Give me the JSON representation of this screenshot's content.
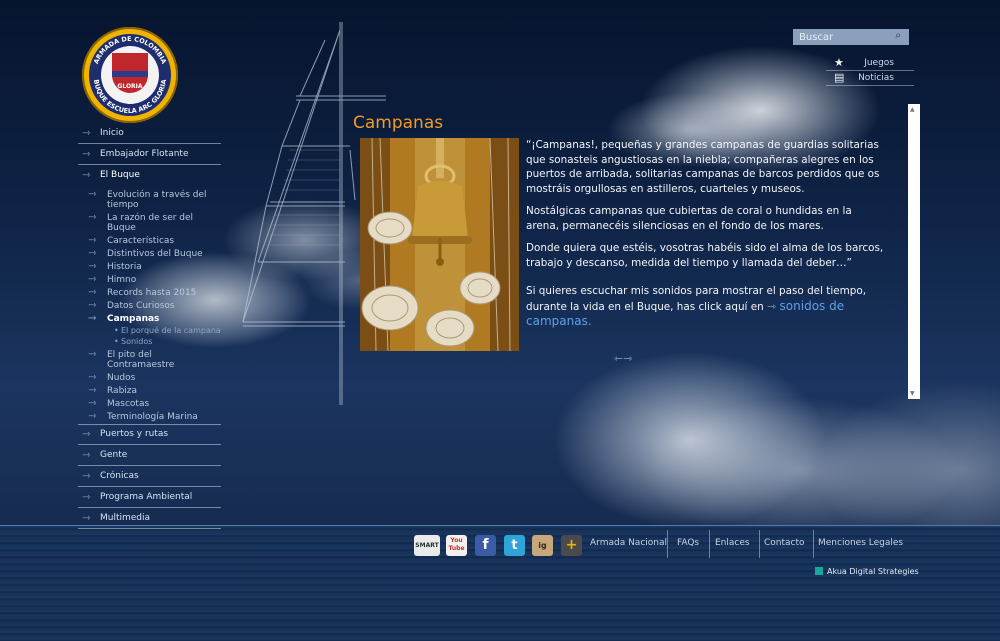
{
  "search": {
    "placeholder": "Buscar",
    "icon": "search-icon"
  },
  "quick_links": [
    {
      "label": "Juegos",
      "icon": "star-icon"
    },
    {
      "label": "Noticias",
      "icon": "document-icon"
    }
  ],
  "logo": {
    "text_top": "ARMADA DE COLOMBIA",
    "text_bottom": "BUQUE ESCUELA ARC GLORIA",
    "center": "GLORIA"
  },
  "nav": {
    "items_top": [
      "Inicio",
      "Embajador Flotante",
      "El Buque"
    ],
    "sub_items": [
      "Evolución a través del tiempo",
      "La razón de ser del Buque",
      "Características",
      "Distintivos del Buque",
      "Historia",
      "Himno",
      "Records hasta 2015",
      "Datos Curiosos",
      "Campanas"
    ],
    "sub_sub_items": [
      "El porqué de la campana",
      "Sonidos"
    ],
    "sub_items_after": [
      "El pito del Contramaestre",
      "Nudos",
      "Rabiza",
      "Mascotas",
      "Terminología Marina"
    ],
    "items_bottom": [
      "Puertos y rutas",
      "Gente",
      "Crónicas",
      "Programa Ambiental",
      "Multimedia"
    ]
  },
  "content": {
    "title": "Campanas",
    "paragraphs": [
      "“¡Campanas!, pequeñas y grandes campanas de guardias solitarias que sonasteis angustiosas en la niebla; compañeras alegres en los puertos de arribada, solitarias campanas de barcos perdidos que os mostráis orgullosas en astilleros, cuarteles y museos.",
      "Nostálgicas campanas que cubiertas de coral o hundidas en la arena, permanecéis silenciosas en el fondo de los mares.",
      "Donde quiera que estéis, vosotras habéis sido el alma de los barcos, trabajo y descanso, medida del tiempo y llamada del deber…”"
    ],
    "last_paragraph": "Si quieres escuchar mis sonidos para mostrar el paso del tiempo, durante la vida en el Buque, has click aquí en",
    "link": "sonidos de campanas."
  },
  "footer": {
    "social": [
      {
        "name": "smart-icon",
        "label": "SMART"
      },
      {
        "name": "youtube-icon",
        "label": "You Tube"
      },
      {
        "name": "facebook-icon",
        "label": "f"
      },
      {
        "name": "twitter-icon",
        "label": "t"
      },
      {
        "name": "instagram-icon",
        "label": "ig"
      },
      {
        "name": "plus-icon",
        "label": "+"
      }
    ],
    "links": [
      "Armada Nacional",
      "FAQs",
      "Enlaces",
      "Contacto",
      "Menciones Legales"
    ],
    "credit": "Akua Digital Strategies"
  },
  "colors": {
    "title": "#f19a28",
    "link": "#5aa2e6",
    "credit": "#19a7a0"
  }
}
